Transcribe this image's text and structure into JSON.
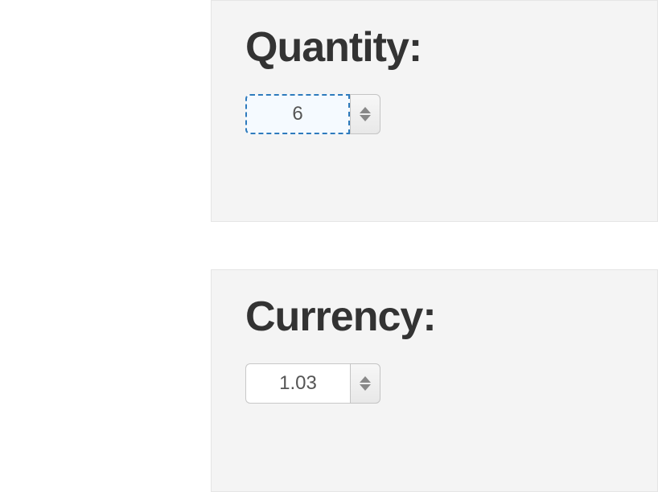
{
  "quantity": {
    "label": "Quantity:",
    "value": "6",
    "focused": true
  },
  "currency": {
    "label": "Currency:",
    "value": "1.03",
    "focused": false
  }
}
